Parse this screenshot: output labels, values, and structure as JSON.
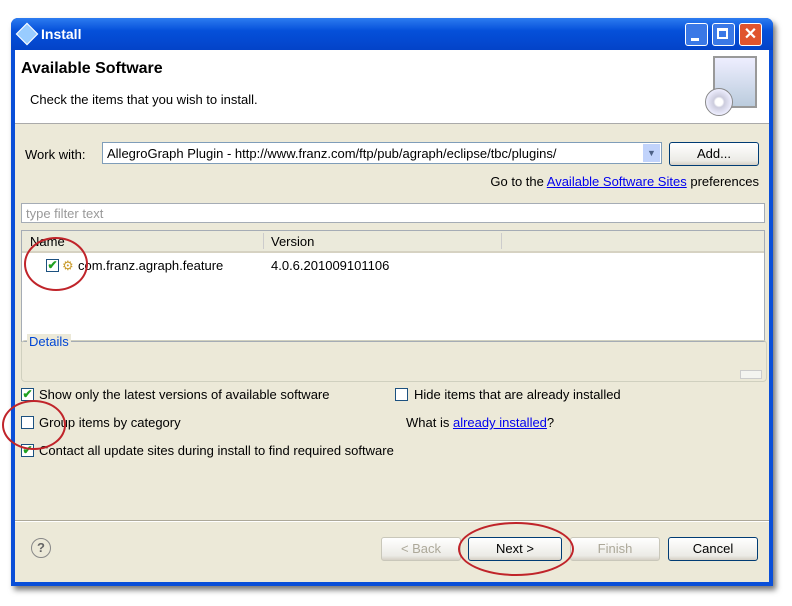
{
  "window": {
    "title": "Install"
  },
  "header": {
    "title": "Available Software",
    "subtitle": "Check the items that you wish to install."
  },
  "work_with": {
    "label": "Work with:",
    "value": "AllegroGraph Plugin - http://www.franz.com/ftp/pub/agraph/eclipse/tbc/plugins/",
    "add_label": "Add..."
  },
  "sites": {
    "prefix": "Go to the",
    "link": "Available Software Sites",
    "suffix": "preferences"
  },
  "filter": {
    "placeholder": "type filter text"
  },
  "table": {
    "columns": [
      "Name",
      "Version"
    ],
    "rows": [
      {
        "name": "com.franz.agraph.feature",
        "version": "4.0.6.201009101106",
        "checked": true
      }
    ]
  },
  "details": {
    "label": "Details"
  },
  "options": {
    "latest": {
      "label": "Show only the latest versions of available software",
      "checked": true
    },
    "hide": {
      "label": "Hide items that are already installed",
      "checked": false
    },
    "group": {
      "label": "Group items by category",
      "checked": false
    },
    "contact": {
      "label": "Contact all update sites during install to find required software",
      "checked": true
    },
    "what_is": "What is",
    "already_installed": "already installed",
    "q": "?"
  },
  "buttons": {
    "help": "?",
    "back": "< Back",
    "next": "Next >",
    "finish": "Finish",
    "cancel": "Cancel"
  },
  "check_glyph": "✔"
}
